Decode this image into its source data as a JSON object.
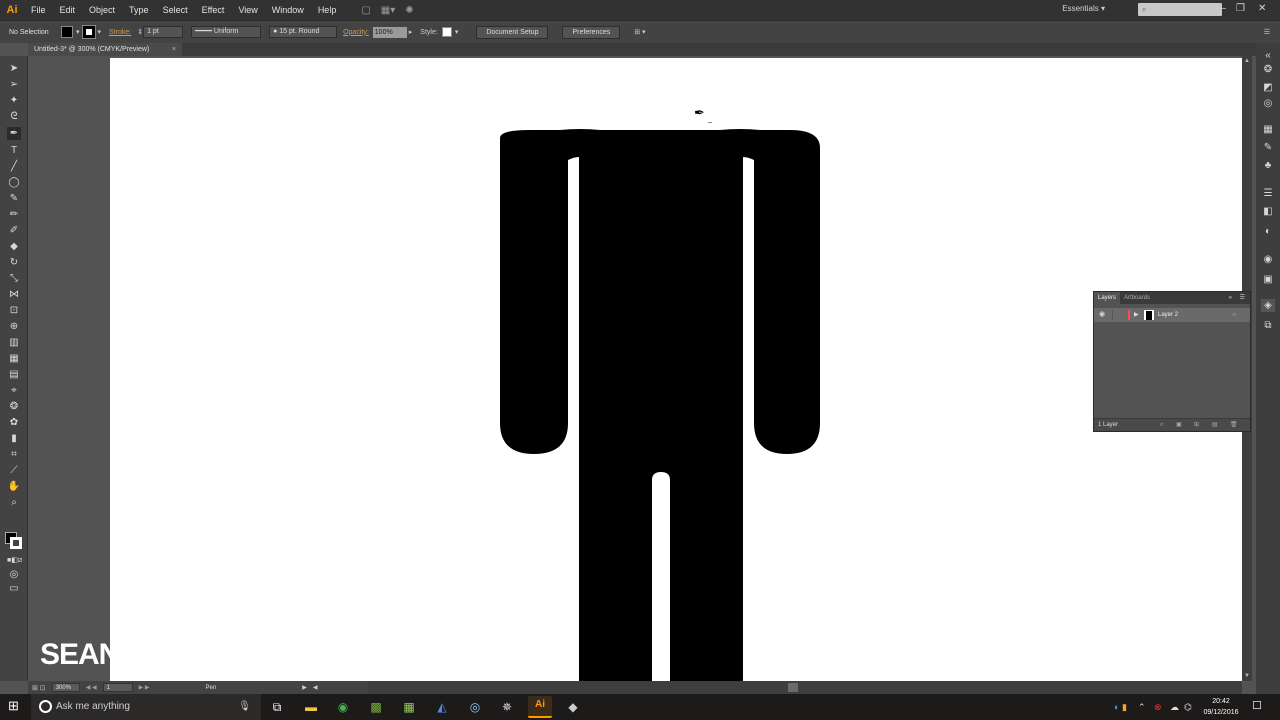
{
  "app": {
    "logo": "Ai",
    "brand_color": "#FF9A00"
  },
  "menu": [
    "File",
    "Edit",
    "Object",
    "Type",
    "Select",
    "Effect",
    "View",
    "Window",
    "Help"
  ],
  "workspace": "Essentials",
  "control_bar": {
    "selection": "No Selection",
    "stroke_label": "Stroke:",
    "stroke_weight": "1 pt",
    "stroke_profile": "Uniform",
    "brush": "15 pt. Round",
    "opacity_label": "Opacity:",
    "opacity_value": "100%",
    "style_label": "Style:",
    "document_setup": "Document Setup",
    "preferences": "Preferences"
  },
  "document_tab": {
    "title": "Untitled-3* @ 300% (CMYK/Preview)",
    "close": "×"
  },
  "watermark": "SEAN",
  "status_bar": {
    "zoom": "300%",
    "artboard": "1",
    "tool": "Pen"
  },
  "layers_panel": {
    "tabs": [
      "Layers",
      "Artboards"
    ],
    "layers": [
      {
        "name": "Layer 2",
        "color": "#FF4A4A"
      }
    ],
    "count": "1 Layer"
  },
  "taskbar": {
    "search_placeholder": "Ask me anything",
    "time": "20:42",
    "date": "09/12/2016"
  }
}
